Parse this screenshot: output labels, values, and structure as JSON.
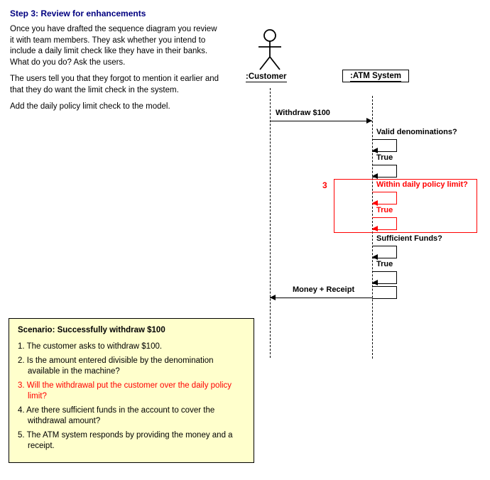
{
  "header": {
    "title": "Step  3: Review for enhancements"
  },
  "body": {
    "p1": "Once you have drafted the sequence diagram you review it with team members.  They ask whether you intend to include a daily limit check like they have in their banks.  What do you do?  Ask the users.",
    "p2": "The users tell you that they forgot to mention it earlier and that they do want the limit check in the system.",
    "p3": "Add the daily policy limit check to the model."
  },
  "scenario": {
    "title": "Scenario:  Successfully withdraw $100",
    "items": [
      "1. The customer asks to withdraw $100.",
      "2. Is the amount entered divisible by the denomination available in the machine?",
      "3. Will the withdrawal put the customer over the daily policy limit?",
      "4. Are there sufficient funds in the account to cover the withdrawal amount?",
      "5. The ATM system responds by providing the money and a receipt."
    ],
    "highlight_index": 2
  },
  "diagram": {
    "actor": ":Customer",
    "system": ":ATM System",
    "step_num": "3",
    "msgs": {
      "withdraw": "Withdraw $100",
      "valid_denom": "Valid denominations?",
      "true1": "True",
      "daily_limit": "Within daily policy limit?",
      "true2": "True",
      "suff_funds": "Sufficient Funds?",
      "true3": "True",
      "money_receipt": "Money + Receipt"
    }
  },
  "chart_data": {
    "type": "sequence_diagram",
    "participants": [
      {
        "name": ":Customer",
        "kind": "actor"
      },
      {
        "name": ":ATM System",
        "kind": "system"
      }
    ],
    "interactions": [
      {
        "from": ":Customer",
        "to": ":ATM System",
        "label": "Withdraw $100",
        "type": "sync"
      },
      {
        "from": ":ATM System",
        "to": ":ATM System",
        "label": "Valid denominations?",
        "type": "self"
      },
      {
        "from": ":ATM System",
        "to": ":ATM System",
        "label": "True",
        "type": "self_return"
      },
      {
        "from": ":ATM System",
        "to": ":ATM System",
        "label": "Within daily policy limit?",
        "type": "self",
        "highlight": true
      },
      {
        "from": ":ATM System",
        "to": ":ATM System",
        "label": "True",
        "type": "self_return",
        "highlight": true
      },
      {
        "from": ":ATM System",
        "to": ":ATM System",
        "label": "Sufficient Funds?",
        "type": "self"
      },
      {
        "from": ":ATM System",
        "to": ":ATM System",
        "label": "True",
        "type": "self_return"
      },
      {
        "from": ":ATM System",
        "to": ":Customer",
        "label": "Money + Receipt",
        "type": "return"
      }
    ]
  }
}
